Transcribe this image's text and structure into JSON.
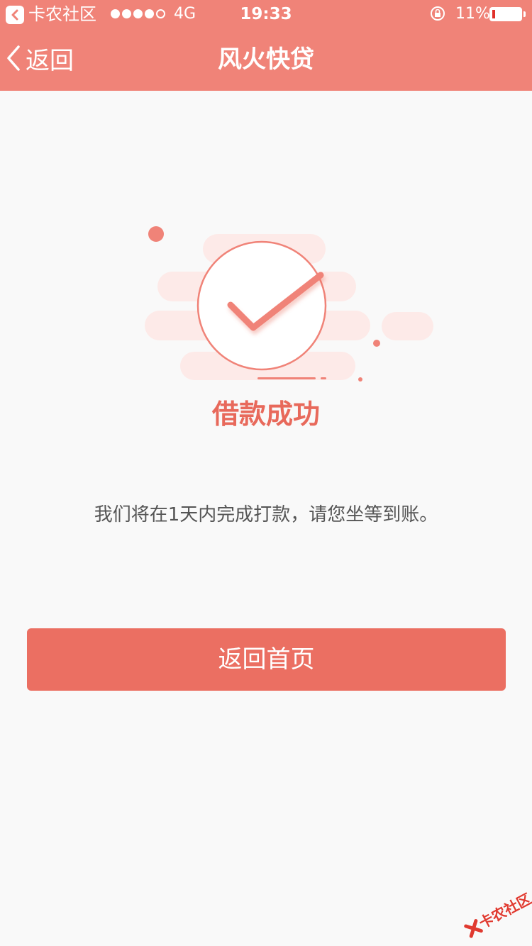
{
  "status_bar": {
    "app_name": "卡农社区",
    "carrier_signal": "●●●●○",
    "network": "4G",
    "time": "19:33",
    "battery_percent": "11%"
  },
  "nav": {
    "back_label": "返回",
    "title": "风火快贷"
  },
  "result": {
    "title": "借款成功",
    "message": "我们将在1天内完成打款，请您坐等到账。"
  },
  "actions": {
    "home_button_label": "返回首页"
  },
  "watermark": {
    "text": "卡农社区"
  },
  "colors": {
    "header": "#f08378",
    "accent": "#e8695b",
    "button": "#eb6f62",
    "background": "#f9f9f9"
  },
  "icons": {
    "status_back": "chevron-left-icon",
    "nav_back": "chevron-left-icon",
    "success": "check-circle-icon",
    "orientation_lock": "lock-rotation-icon"
  }
}
